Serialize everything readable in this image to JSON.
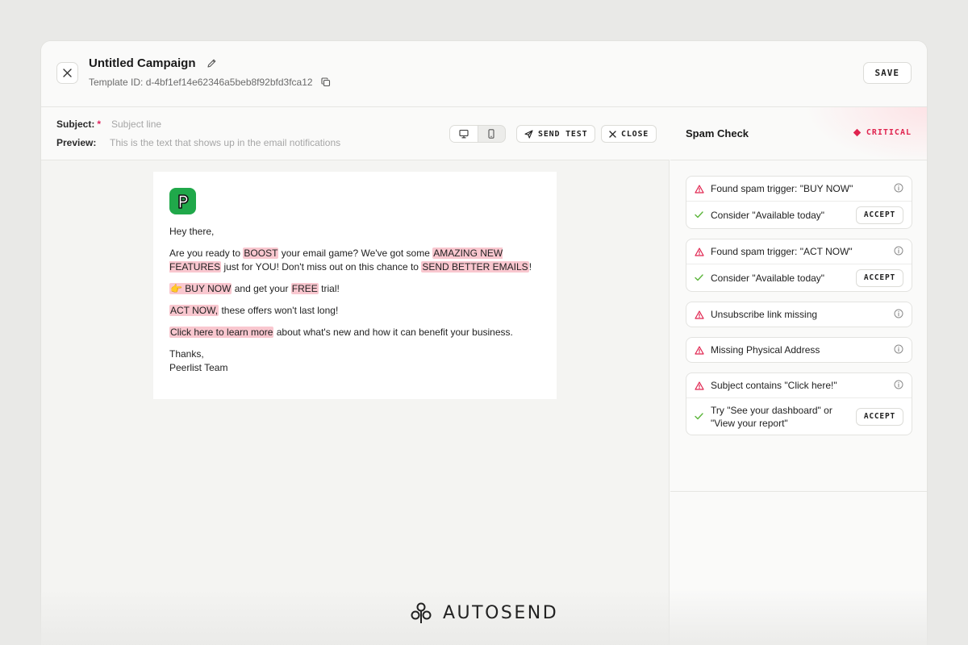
{
  "header": {
    "title": "Untitled Campaign",
    "template_id": "Template ID: d-4bf1ef14e62346a5beb8f92bfd3fca12",
    "save_label": "SAVE"
  },
  "meta": {
    "subject_label": "Subject:",
    "subject_required": "*",
    "subject_placeholder": "Subject line",
    "preview_label": "Preview:",
    "preview_placeholder": "This is the text that shows up in the email notifications",
    "send_test_label": "SEND TEST",
    "close_label": "CLOSE"
  },
  "email": {
    "logo_letter": "P",
    "greeting": "Hey there,",
    "p1": {
      "t1": "Are you ready to ",
      "h1": "BOOST",
      "t2": " your email game? We've got some ",
      "h2": "AMAZING NEW FEATURES",
      "t3": " just for YOU! Don't miss out on this chance to ",
      "h3": "SEND BETTER EMAILS",
      "t4": "!"
    },
    "p2": {
      "h1": "👉 BUY NOW",
      "t1": " and get your ",
      "h2": "FREE",
      "t2": " trial!"
    },
    "p3": {
      "h1": "ACT NOW,",
      "t1": " these offers won't last long!"
    },
    "p4": {
      "h1": "Click here to learn more",
      "t1": " about what's new and how it can benefit your business."
    },
    "sign1": "Thanks,",
    "sign2": "Peerlist Team"
  },
  "spam_check": {
    "title": "Spam Check",
    "severity": "CRITICAL",
    "severity_color": "#e0244f",
    "accept_label": "ACCEPT",
    "issues": [
      {
        "pre": "Found spam trigger: ",
        "bold": "\"BUY NOW\"",
        "post": "",
        "suggest_pre": "Consider ",
        "suggest_bold": "\"Available today\"",
        "suggest_post": ""
      },
      {
        "pre": "Found spam trigger: ",
        "bold": "\"ACT NOW\"",
        "post": "",
        "suggest_pre": "Consider ",
        "suggest_bold": "\"Available today\"",
        "suggest_post": ""
      },
      {
        "pre": "",
        "bold": "Unsubscribe",
        "post": " link missing"
      },
      {
        "pre": "Missing Physical Address",
        "bold": "",
        "post": ""
      },
      {
        "pre": "Subject contains ",
        "bold": "\"Click here!\"",
        "post": "",
        "suggest_pre": "Try ",
        "suggest_bold": "\"See your dashboard\"",
        "suggest_mid": " or ",
        "suggest_bold2": "\"View your report\""
      }
    ]
  },
  "brand": {
    "name": "AUTOSEND"
  }
}
